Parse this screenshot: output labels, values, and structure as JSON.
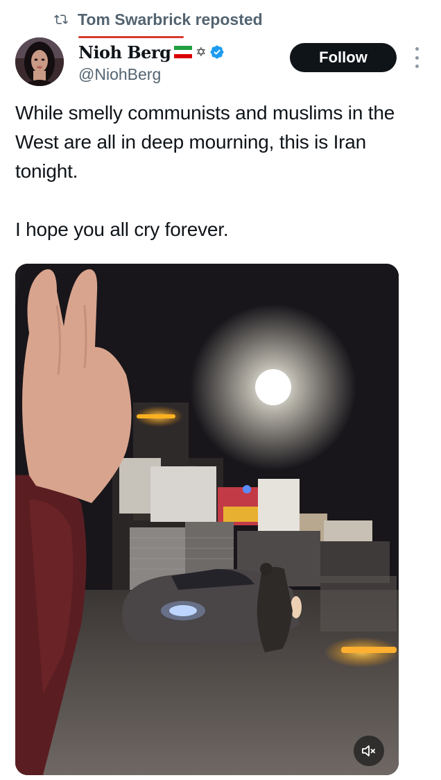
{
  "repost": {
    "text": "Tom Swarbrick reposted",
    "icon": "repost-icon"
  },
  "author": {
    "display_name": "Nioh Berg",
    "handle": "@NiohBerg",
    "badges": [
      "iran-flag-icon",
      "star-of-david-icon",
      "verified-badge-icon"
    ],
    "verified_color": "#1d9bf0"
  },
  "actions": {
    "follow_label": "Follow",
    "more_icon": "more-vertical-icon"
  },
  "tweet": {
    "paragraphs": [
      "While smelly communists and muslims in the West are all in deep mourning, this is Iran tonight.",
      "I hope you all cry forever."
    ]
  },
  "media": {
    "type": "video",
    "mute_icon": "volume-muted-icon"
  },
  "colors": {
    "text": "#0f1419",
    "secondary": "#536471",
    "button_bg": "#0f1419"
  }
}
